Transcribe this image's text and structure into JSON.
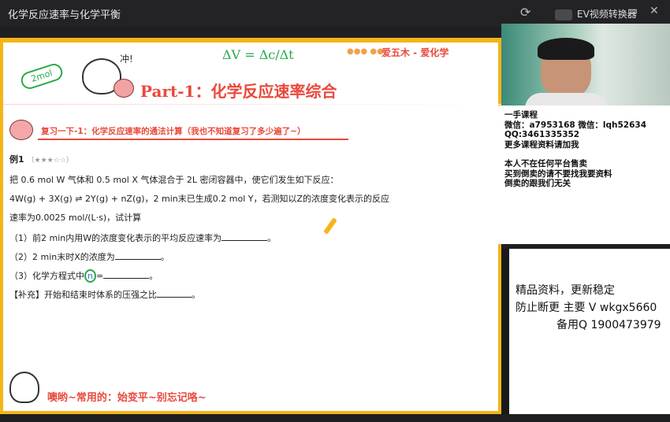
{
  "window": {
    "title": "化学反应速率与化学平衡",
    "brand": "EV视频转换器",
    "refresh_icon": "refresh-icon",
    "minimize_symbol": "▭",
    "close_symbol": "✕"
  },
  "slide": {
    "logo_text": "爱五木 - 爱化学",
    "logo_blobs": "●●● ●●",
    "hand_note": "2mol",
    "formula": "ΔV = Δc/Δt",
    "chong": "冲!",
    "part_title_prefix": "Part-1：",
    "part_title_main": "化学反应速率综合",
    "review_text": "复习一下-1：化学反应速率的通法计算（我也不知道复习了多少遍了~）",
    "example_label": "例1",
    "example_stars": "（★★★☆☆）",
    "question_lines": [
      "把 0.6 mol W 气体和 0.5 mol X 气体混合于 2L 密闭容器中，使它们发生如下反应：",
      "4W(g) + 3X(g) ⇌ 2Y(g) + nZ(g)，2 min末已生成0.2 mol Y，若测知以Z的浓度变化表示的反应",
      "速率为0.0025 mol/(L·s)，试计算"
    ],
    "sub1": "（1）前2 min内用W的浓度变化表示的平均反应速率为",
    "sub2": "（2）2 min末时X的浓度为",
    "sub3_pre": "（3）化学方程式中",
    "sub3_n": "n",
    "sub3_post": "=",
    "supp": "【补充】开始和结束时体系的压强之比",
    "period": "。",
    "footer": "噢哟~常用的：始变平~别忘记咯~"
  },
  "notice": {
    "lines": [
      "一手课程",
      "微信：a7953168 微信：lqh52634",
      "QQ:3461335352",
      "更多课程资料请加我",
      "",
      "本人不在任何平台售卖",
      "买到倒卖的请不要找我要资料",
      "倒卖的跟我们无关"
    ]
  },
  "notice2": {
    "l1": "精品资料，更新稳定",
    "l2": "防止断更 主要 V wkgx5660",
    "l3": "备用Q 1900473979"
  }
}
